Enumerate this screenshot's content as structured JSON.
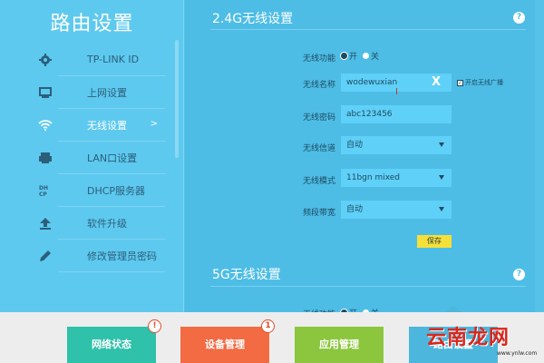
{
  "sidebar": {
    "title": "路由设置",
    "items": [
      {
        "label": "TP-LINK ID",
        "icon": "gear-icon"
      },
      {
        "label": "上网设置",
        "icon": "monitor-icon"
      },
      {
        "label": "无线设置",
        "icon": "wifi-icon",
        "arrow": ">"
      },
      {
        "label": "LAN口设置",
        "icon": "lan-icon"
      },
      {
        "label": "DHCP服务器",
        "icon": "dhcp-icon"
      },
      {
        "label": "软件升级",
        "icon": "upload-icon"
      },
      {
        "label": "修改管理员密码",
        "icon": "pencil-icon"
      }
    ]
  },
  "wifi24": {
    "title": "2.4G无线设置",
    "help": "?",
    "func_label": "无线功能",
    "func_on": "开",
    "func_off": "关",
    "ssid_label": "无线名称",
    "ssid_value": "wodewuxian",
    "clear_icon": "X",
    "broadcast_label": "开启无线广播",
    "password_label": "无线密码",
    "password_value": "abc123456",
    "channel_label": "无线信道",
    "channel_value": "自动",
    "mode_label": "无线模式",
    "mode_value": "11bgn mixed",
    "bandwidth_label": "频段带宽",
    "bandwidth_value": "自动",
    "save_label": "保存"
  },
  "wifi5": {
    "title": "5G无线设置",
    "help": "?",
    "func_label": "无线功能",
    "func_on": "开",
    "func_off": "关"
  },
  "bottom": {
    "tiles": [
      {
        "label": "网络状态",
        "color": "#2fc1a9",
        "badge": "!"
      },
      {
        "label": "设备管理",
        "color": "#f26b43",
        "badge": "1"
      },
      {
        "label": "应用管理",
        "color": "#8cc63f"
      },
      {
        "label": "路由设置",
        "color": "#4db6dc"
      }
    ]
  },
  "watermark": {
    "text": "云南龙网",
    "url": "www.ynlw.com"
  },
  "colors": {
    "sidebar_bg": "#5ec9ef",
    "main_bg": "#4dbde6",
    "field_bg": "#5fd0f7",
    "save_button": "#f5e03a"
  }
}
